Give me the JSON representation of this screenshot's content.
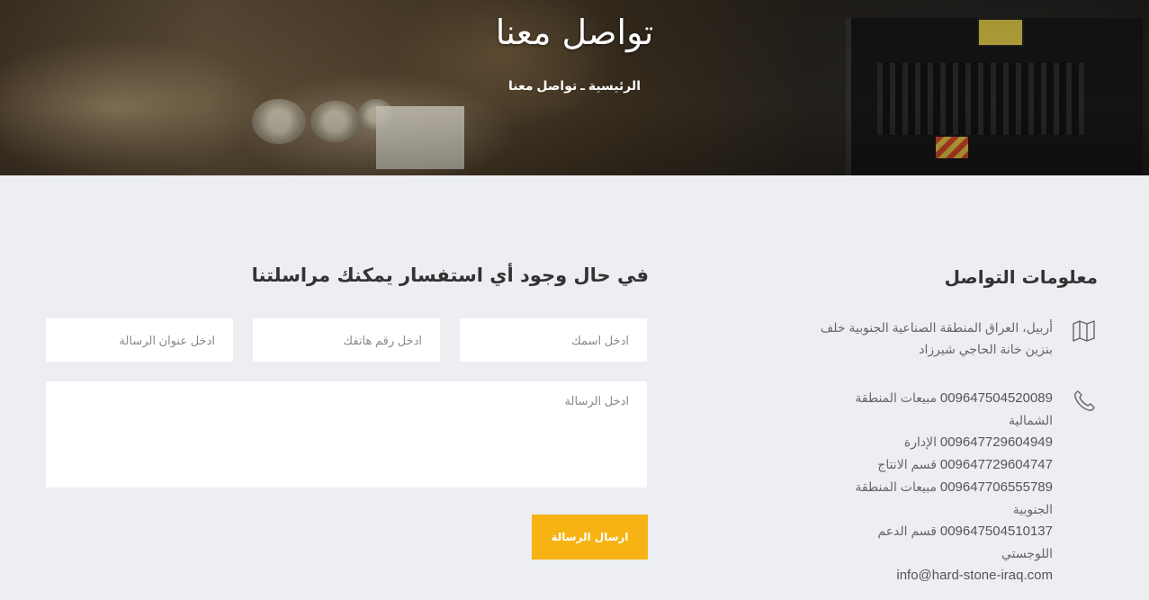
{
  "hero": {
    "title": "تواصل معنا",
    "breadcrumb_home": "الرئيسية",
    "breadcrumb_sep": " ـ ",
    "breadcrumb_current": "تواصل معنا"
  },
  "contact_info": {
    "title": "معلومات التواصل",
    "address_icon": "map-icon",
    "address_line1": "أربيل، العراق المنطقة الصناعية الجنوبية خلف",
    "address_line2": "بنزين خانة الحاجي شيرزاد",
    "phone_icon": "phone-icon",
    "phones": [
      {
        "number": "009647504520089",
        "label": "مبيعات المنطقة",
        "label_cont": "الشمالية"
      },
      {
        "number": "009647729604949",
        "label": "الإدارة",
        "label_cont": ""
      },
      {
        "number": "009647729604747",
        "label": "قسم الانتاج",
        "label_cont": ""
      },
      {
        "number": "009647706555789",
        "label": "مبيعات المنطقة",
        "label_cont": "الجنوبية"
      },
      {
        "number": "009647504510137",
        "label": "قسم الدعم اللوجستي",
        "label_cont": ""
      }
    ],
    "email": "info@hard-stone-iraq.com"
  },
  "form": {
    "title": "في حال وجود أي استفسار يمكنك مراسلتنا",
    "name_placeholder": "ادخل اسمك",
    "phone_placeholder": "ادخل رقم هاتفك",
    "subject_placeholder": "ادخل عنوان الرسالة",
    "message_placeholder": "ادخل الرسالة",
    "submit_label": "ارسال الرسالة"
  },
  "colors": {
    "accent": "#f6b313",
    "background": "#eceef2",
    "text": "#333333"
  }
}
